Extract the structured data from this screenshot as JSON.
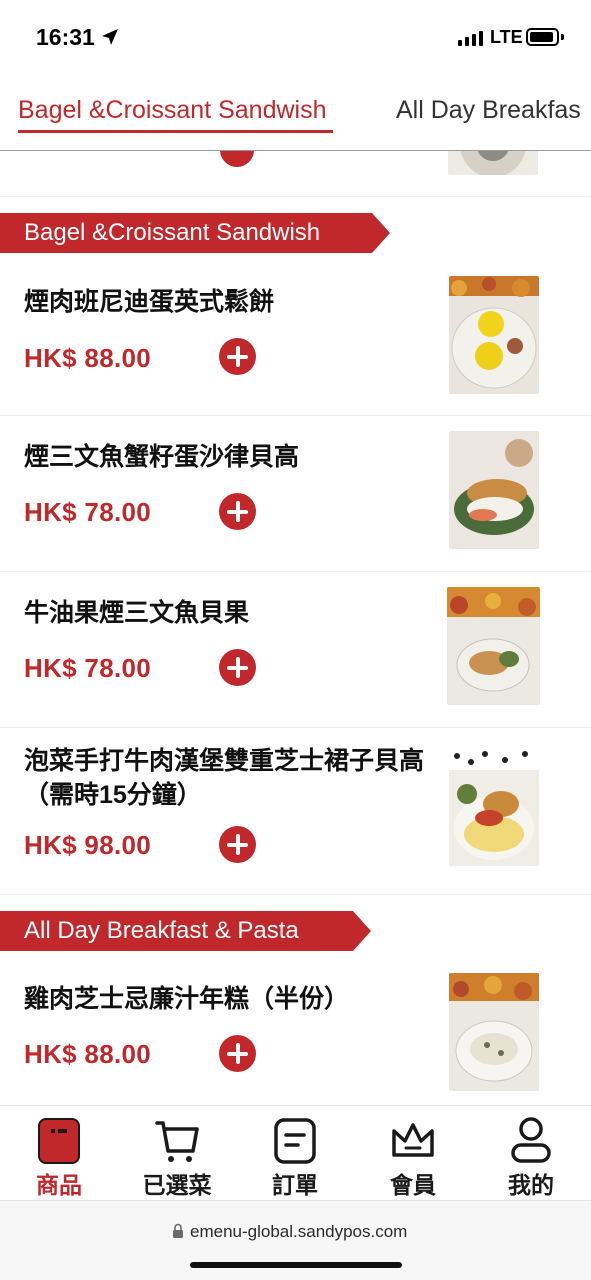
{
  "status_bar": {
    "time": "16:31",
    "network": "LTE",
    "icons": [
      "location-arrow-icon",
      "signal-bars-icon",
      "battery-icon"
    ]
  },
  "tabs": [
    {
      "label": "Bagel &Croissant Sandwish",
      "active": true
    },
    {
      "label": "All Day Breakfas",
      "active": false
    }
  ],
  "sections": [
    {
      "title": "Bagel &Croissant Sandwish",
      "items": [
        {
          "name": "煙肉班尼迪蛋英式鬆餅",
          "price": "HK$ 88.00"
        },
        {
          "name": "煙三文魚蟹籽蛋沙律貝高",
          "price": "HK$ 78.00"
        },
        {
          "name": "牛油果煙三文魚貝果",
          "price": "HK$ 78.00"
        },
        {
          "name": "泡菜手打牛肉漢堡雙重芝士裙子貝高（需時15分鐘）",
          "price": "HK$ 98.00"
        }
      ]
    },
    {
      "title": "All Day Breakfast & Pasta",
      "items": [
        {
          "name": "雞肉芝士忌廉汁年糕（半份）",
          "price": "HK$ 88.00"
        }
      ]
    }
  ],
  "bottom_nav": [
    {
      "label": "商品",
      "icon": "product-bag-icon",
      "active": true
    },
    {
      "label": "已選菜",
      "icon": "cart-icon",
      "active": false
    },
    {
      "label": "訂單",
      "icon": "order-list-icon",
      "active": false
    },
    {
      "label": "會員",
      "icon": "crown-icon",
      "active": false
    },
    {
      "label": "我的",
      "icon": "person-icon",
      "active": false
    }
  ],
  "browser": {
    "url": "emenu-global.sandypos.com",
    "lock_icon": "lock-icon"
  },
  "colors": {
    "accent": "#c0282c",
    "text": "#1a1a1a"
  }
}
